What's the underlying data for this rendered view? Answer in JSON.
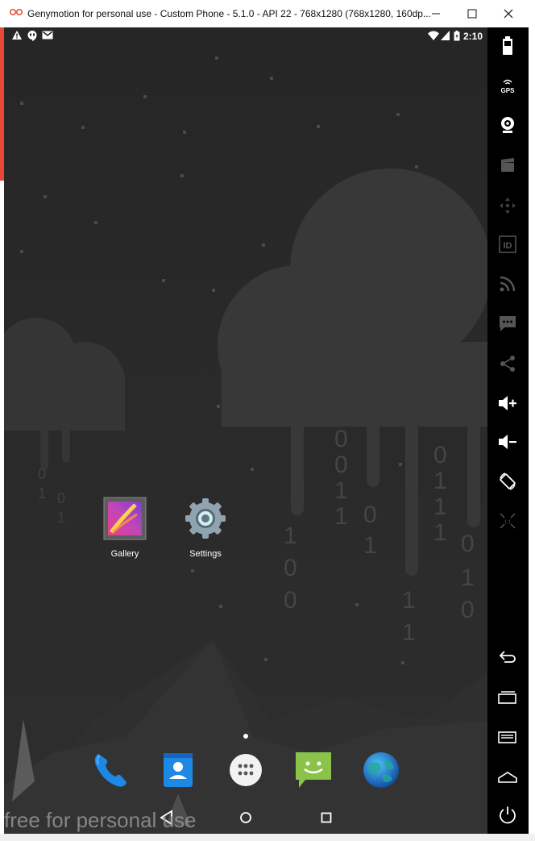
{
  "window": {
    "title": "Genymotion for personal use - Custom Phone - 5.1.0 - API 22 - 768x1280 (768x1280, 160dp...",
    "controls": [
      "minimize",
      "maximize",
      "close"
    ]
  },
  "statusbar": {
    "time": "2:10",
    "left_icons": [
      "alert-icon",
      "hangouts-icon",
      "gmail-icon"
    ],
    "right_icons": [
      "wifi-icon",
      "signal-icon",
      "battery-icon"
    ]
  },
  "home": {
    "apps": [
      {
        "label": "Gallery",
        "icon": "gallery-icon"
      },
      {
        "label": "Settings",
        "icon": "settings-gear-icon"
      }
    ],
    "dock": [
      "phone-icon",
      "contacts-icon",
      "app-drawer-icon",
      "messaging-icon",
      "browser-icon"
    ],
    "page_indicator": {
      "count": 1,
      "active": 1
    },
    "wallpaper_digits": [
      "0",
      "0",
      "1",
      "1",
      "0",
      "1",
      "0",
      "1",
      "1",
      "1",
      "0",
      "1",
      "0",
      "1",
      "0",
      "0",
      "1",
      "1",
      "0",
      "1",
      "0",
      "1"
    ]
  },
  "navbar": [
    "back-icon",
    "home-icon",
    "recents-icon"
  ],
  "watermark": "free for personal use",
  "toolbar": {
    "gps_label": "GPS",
    "id_label": "ID",
    "items": [
      "battery-icon",
      "gps-icon",
      "webcam-icon",
      "capture-icon",
      "dpad-icon",
      "id-icon",
      "rss-icon",
      "sms-icon",
      "share-icon",
      "volume-up-icon",
      "volume-down-icon",
      "rotate-icon",
      "scale-icon",
      "back-icon",
      "recent-apps-icon",
      "menu-icon",
      "home-icon",
      "power-icon"
    ]
  },
  "colors": {
    "titlebar_bg": "#ffffff",
    "phone_bg": "#2a2a2a",
    "cloud": "#3a3a3a",
    "toolbar_bg": "#000000",
    "accent_red": "#e8473a"
  }
}
